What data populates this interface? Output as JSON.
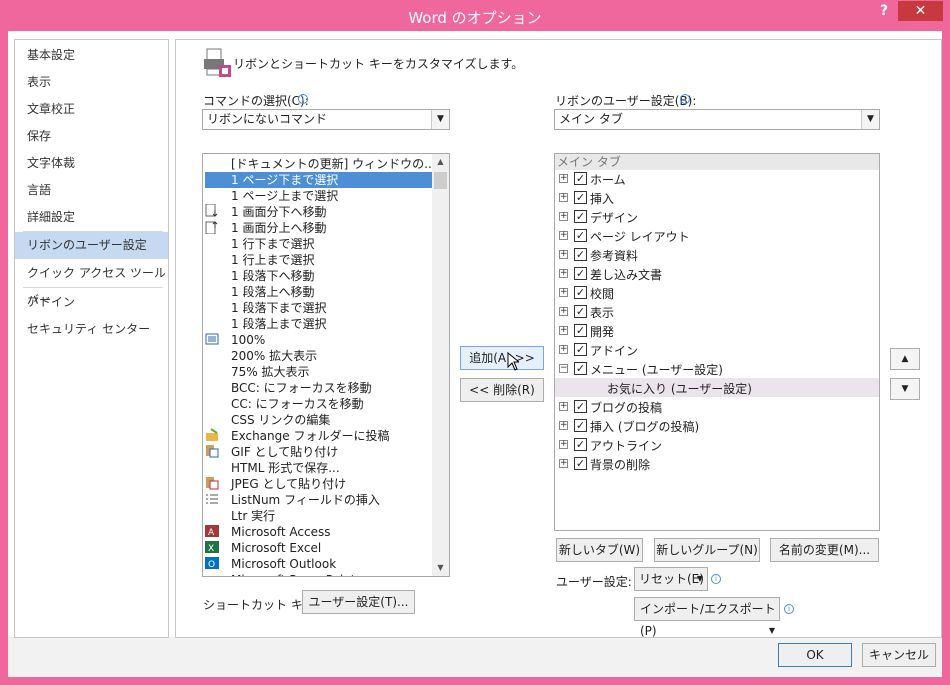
{
  "window": {
    "title": "Word のオプション",
    "help_label": "?",
    "close_label": "✕"
  },
  "nav": {
    "items": [
      {
        "label": "基本設定"
      },
      {
        "label": "表示"
      },
      {
        "label": "文章校正"
      },
      {
        "label": "保存"
      },
      {
        "label": "文字体裁"
      },
      {
        "label": "言語"
      },
      {
        "label": "詳細設定"
      },
      {
        "label": "リボンのユーザー設定"
      },
      {
        "label": "クイック アクセス ツール バー"
      },
      {
        "label": "アドイン"
      },
      {
        "label": "セキュリティ センター"
      }
    ],
    "selected_index": 7
  },
  "header": {
    "description": "リボンとショートカット キーをカスタマイズします。"
  },
  "commands": {
    "label": "コマンドの選択(C):",
    "selected": "リボンにないコマンド",
    "items": [
      "[ドキュメントの更新] ウィンドウの...",
      "1 ページ下まで選択",
      "1 ページ上まで選択",
      "1 画面分下へ移動",
      "1 画面分上へ移動",
      "1 行下まで選択",
      "1 行上まで選択",
      "1 段落下へ移動",
      "1 段落上へ移動",
      "1 段落下まで選択",
      "1 段落上まで選択",
      "100%",
      "200% 拡大表示",
      "75% 拡大表示",
      "BCC: にフォーカスを移動",
      "CC: にフォーカスを移動",
      "CSS リンクの編集",
      "Exchange フォルダーに投稿",
      "GIF として貼り付け",
      "HTML 形式で保存...",
      "JPEG として貼り付け",
      "ListNum フィールドの挿入",
      "Ltr 実行",
      "Microsoft Access",
      "Microsoft Excel",
      "Microsoft Outlook",
      "Microsoft PowerPoint"
    ],
    "selected_index": 1
  },
  "ribbon": {
    "label": "リボンのユーザー設定(B):",
    "selected": "メイン タブ",
    "header": "メイン タブ",
    "tabs": [
      {
        "label": "ホーム"
      },
      {
        "label": "挿入"
      },
      {
        "label": "デザイン"
      },
      {
        "label": "ページ レイアウト"
      },
      {
        "label": "参考資料"
      },
      {
        "label": "差し込み文書"
      },
      {
        "label": "校閲"
      },
      {
        "label": "表示"
      },
      {
        "label": "開発"
      },
      {
        "label": "アドイン"
      },
      {
        "label": "メニュー (ユーザー設定)"
      }
    ],
    "child": "お気に入り (ユーザー設定)",
    "tabs2": [
      {
        "label": "ブログの投稿"
      },
      {
        "label": "挿入 (ブログの投稿)"
      },
      {
        "label": "アウトライン"
      },
      {
        "label": "背景の削除"
      }
    ]
  },
  "buttons": {
    "add": "追加(A) >>",
    "remove": "<< 削除(R)",
    "new_tab": "新しいタブ(W)",
    "new_group": "新しいグループ(N)",
    "rename": "名前の変更(M)...",
    "reset": "リセット(E)",
    "import_export": "インポート/エクスポート(P)",
    "shortcut_customize": "ユーザー設定(T)...",
    "ok": "OK",
    "cancel": "キャンセル"
  },
  "labels": {
    "user_settings": "ユーザー設定:",
    "shortcut": "ショートカット キー:"
  },
  "colors": {
    "frame": "#f0679e",
    "selection": "#4d8fd6",
    "nav_selected": "#c5d9f1"
  }
}
